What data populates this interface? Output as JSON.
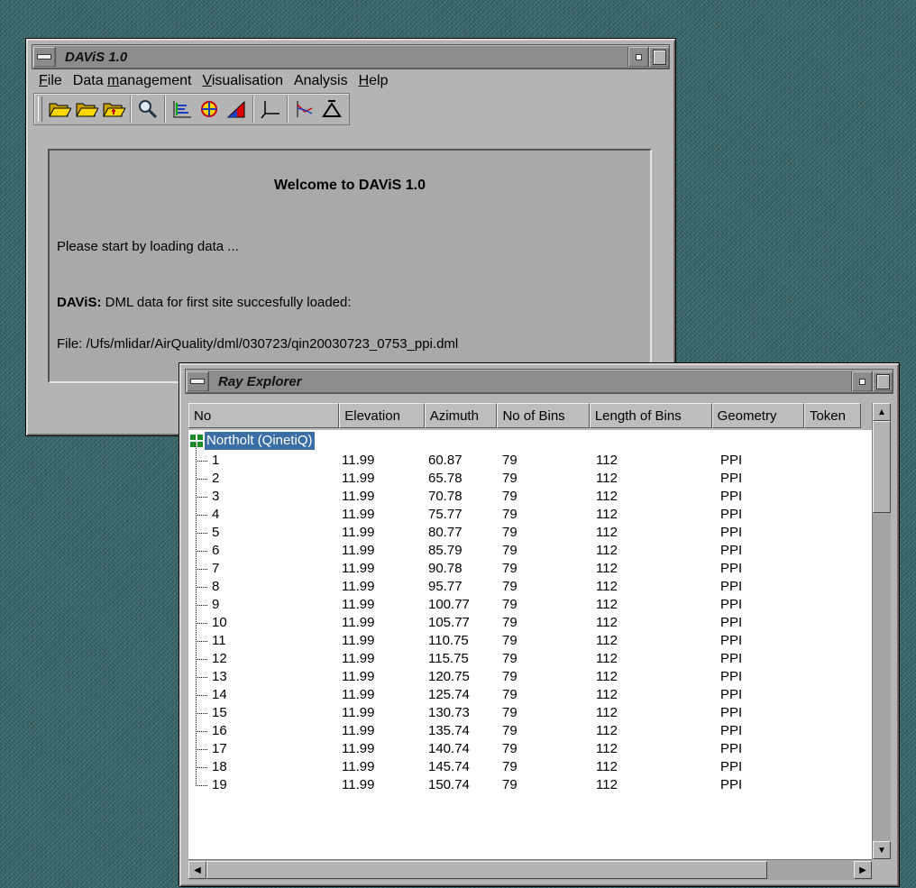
{
  "main_window": {
    "title": "DAViS 1.0",
    "menu": [
      {
        "label": "File",
        "key_index": 0
      },
      {
        "label": "Data management",
        "key_index": 5
      },
      {
        "label": "Visualisation",
        "key_index": 0
      },
      {
        "label": "Analysis",
        "key_index": -1
      },
      {
        "label": "Help",
        "key_index": 0
      }
    ],
    "toolbar_icons": [
      "open-folder-icon",
      "open-folder-icon",
      "open-folder-add-icon",
      "magnifier-icon",
      "chart-bars-icon",
      "wind-rose-icon",
      "triangle-plot-icon",
      "axes-icon",
      "line-plot-icon",
      "triangle-outline-icon"
    ],
    "welcome": {
      "title": "Welcome to DAViS 1.0",
      "prompt": "Please start by loading data ...",
      "status_label": "DAViS:",
      "status_text": " DML data for first site succesfully loaded:",
      "file_line": "File: /Ufs/mlidar/AirQuality/dml/030723/qin20030723_0753_ppi.dml"
    }
  },
  "ray_explorer": {
    "title": "Ray Explorer",
    "columns": [
      "No",
      "Elevation",
      "Azimuth",
      "No of Bins",
      "Length of Bins",
      "Geometry",
      "Token"
    ],
    "site": "Northolt (QinetiQ)",
    "rows": [
      [
        "1",
        "11.99",
        "60.87",
        "79",
        "112",
        "PPI"
      ],
      [
        "2",
        "11.99",
        "65.78",
        "79",
        "112",
        "PPI"
      ],
      [
        "3",
        "11.99",
        "70.78",
        "79",
        "112",
        "PPI"
      ],
      [
        "4",
        "11.99",
        "75.77",
        "79",
        "112",
        "PPI"
      ],
      [
        "5",
        "11.99",
        "80.77",
        "79",
        "112",
        "PPI"
      ],
      [
        "6",
        "11.99",
        "85.79",
        "79",
        "112",
        "PPI"
      ],
      [
        "7",
        "11.99",
        "90.78",
        "79",
        "112",
        "PPI"
      ],
      [
        "8",
        "11.99",
        "95.77",
        "79",
        "112",
        "PPI"
      ],
      [
        "9",
        "11.99",
        "100.77",
        "79",
        "112",
        "PPI"
      ],
      [
        "10",
        "11.99",
        "105.77",
        "79",
        "112",
        "PPI"
      ],
      [
        "11",
        "11.99",
        "110.75",
        "79",
        "112",
        "PPI"
      ],
      [
        "12",
        "11.99",
        "115.75",
        "79",
        "112",
        "PPI"
      ],
      [
        "13",
        "11.99",
        "120.75",
        "79",
        "112",
        "PPI"
      ],
      [
        "14",
        "11.99",
        "125.74",
        "79",
        "112",
        "PPI"
      ],
      [
        "15",
        "11.99",
        "130.73",
        "79",
        "112",
        "PPI"
      ],
      [
        "16",
        "11.99",
        "135.74",
        "79",
        "112",
        "PPI"
      ],
      [
        "17",
        "11.99",
        "140.74",
        "79",
        "112",
        "PPI"
      ],
      [
        "18",
        "11.99",
        "145.74",
        "79",
        "112",
        "PPI"
      ],
      [
        "19",
        "11.99",
        "150.74",
        "79",
        "112",
        "PPI"
      ]
    ]
  },
  "colors": {
    "selection": "#3a6ea5",
    "desktop": "#3d6b6b",
    "window": "#b4b4b4"
  }
}
